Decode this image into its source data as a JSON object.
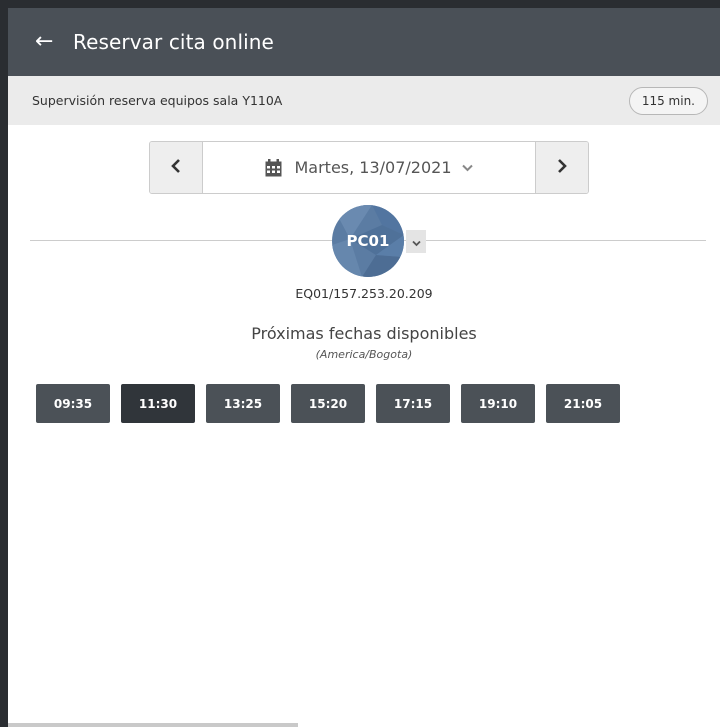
{
  "header": {
    "back_icon": "arrow-left-icon",
    "title": "Reservar cita online"
  },
  "service": {
    "name": "Supervisión reserva equipos sala Y110A",
    "duration": "115 min."
  },
  "date_nav": {
    "prev_icon": "chevron-left-icon",
    "next_icon": "chevron-right-icon",
    "calendar_icon": "calendar-icon",
    "date": "Martes, 13/07/2021"
  },
  "resource": {
    "label": "PC01",
    "identifier": "EQ01/157.253.20.209",
    "avatar_color": "#5b7ca3"
  },
  "availability": {
    "heading": "Próximas fechas disponibles",
    "timezone": "(America/Bogota)",
    "slots": [
      "09:35",
      "11:30",
      "13:25",
      "15:20",
      "17:15",
      "19:10",
      "21:05"
    ],
    "selected_slot": "11:30"
  },
  "colors": {
    "header_bg": "#4a5057",
    "subheader_bg": "#ebebeb",
    "slot_bg": "#4b5157",
    "slot_selected_bg": "#30353a"
  }
}
